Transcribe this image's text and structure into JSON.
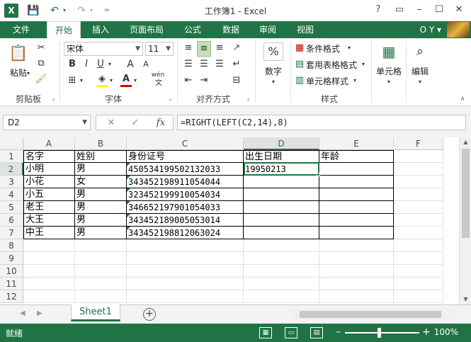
{
  "window": {
    "title": "工作簿1 - Excel",
    "help": "?",
    "restore_ribbon": "▭",
    "minimize": "–",
    "maximize": "☐",
    "close": "✕",
    "app_icon": "X"
  },
  "qat": {
    "save_icon": "💾",
    "undo_icon": "↶",
    "redo_icon": "↷",
    "customize_icon": "="
  },
  "tabs": [
    "文件",
    "开始",
    "插入",
    "页面布局",
    "公式",
    "数据",
    "审阅",
    "视图"
  ],
  "user": "O Y ▾",
  "ribbon": {
    "clipboard": {
      "label": "剪贴板",
      "paste": "粘贴"
    },
    "font": {
      "label": "字体",
      "name": "宋体",
      "size": "11",
      "bold": "B",
      "italic": "I",
      "underline": "U",
      "grow": "A",
      "shrink": "A",
      "wen": "wén"
    },
    "alignment": {
      "label": "对齐方式"
    },
    "number": {
      "label": "数字",
      "percent": "%"
    },
    "styles": {
      "label": "样式",
      "conditional": "条件格式",
      "table": "套用表格格式",
      "cell_styles": "单元格样式"
    },
    "cells": {
      "label": "单元格"
    },
    "editing": {
      "label": "编辑"
    }
  },
  "formula_bar": {
    "name_box": "D2",
    "cancel": "✕",
    "enter": "✓",
    "fx": "fx",
    "formula": "=RIGHT(LEFT(C2,14),8)"
  },
  "columns": [
    "A",
    "B",
    "C",
    "D",
    "E",
    "F"
  ],
  "rows": [
    "1",
    "2",
    "3",
    "4",
    "5",
    "6",
    "7",
    "8",
    "9",
    "10",
    "11",
    "12"
  ],
  "sheet": {
    "header": [
      "名字",
      "姓别",
      "身份证号",
      "出生日期",
      "年龄"
    ],
    "data": [
      [
        "小明",
        "男",
        "450534199502132033",
        "19950213",
        ""
      ],
      [
        "小花",
        "女",
        "343452198911054044",
        "",
        ""
      ],
      [
        "小五",
        "男",
        "323452199910054034",
        "",
        ""
      ],
      [
        "老王",
        "男",
        "346652197901054033",
        "",
        ""
      ],
      [
        "大王",
        "男",
        "343452189005053014",
        "",
        ""
      ],
      [
        "中王",
        "男",
        "343452198812063024",
        "",
        ""
      ]
    ]
  },
  "sheet_tabs": {
    "active": "Sheet1",
    "add": "+"
  },
  "status": {
    "ready": "就绪",
    "zoom_minus": "–",
    "zoom_plus": "+",
    "zoom": "100%"
  },
  "colors": {
    "accent": "#217346",
    "selection": "#c6e0b4"
  }
}
